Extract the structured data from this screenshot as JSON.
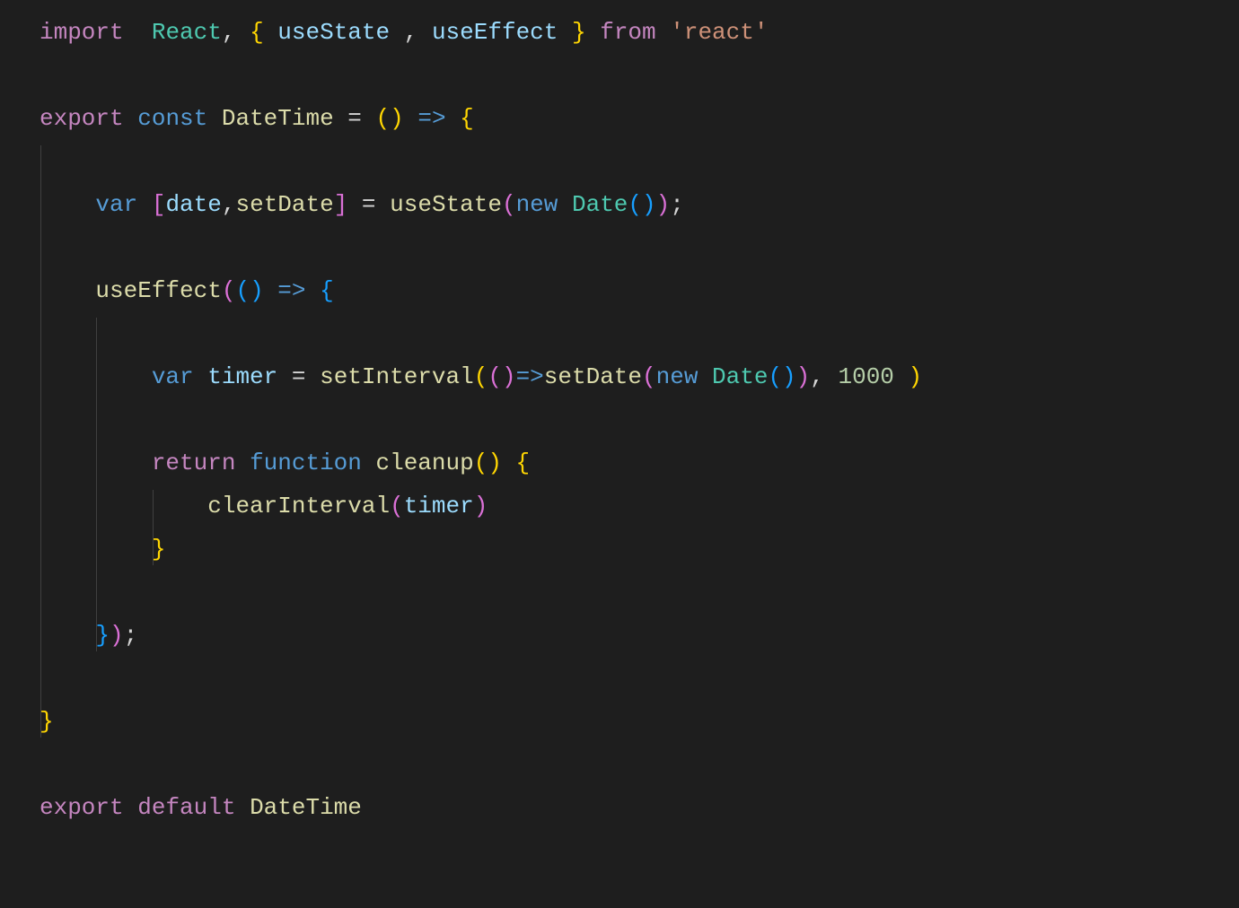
{
  "code": {
    "lines": [
      {
        "indent": 0,
        "tokens": [
          {
            "cls": "kw-import",
            "t": "import"
          },
          {
            "cls": "ident",
            "t": "  "
          },
          {
            "cls": "type",
            "t": "React"
          },
          {
            "cls": "punct",
            "t": ", "
          },
          {
            "cls": "brace-y",
            "t": "{"
          },
          {
            "cls": "ident",
            "t": " "
          },
          {
            "cls": "var-name",
            "t": "useState"
          },
          {
            "cls": "ident",
            "t": " "
          },
          {
            "cls": "punct",
            "t": ","
          },
          {
            "cls": "ident",
            "t": " "
          },
          {
            "cls": "var-name",
            "t": "useEffect"
          },
          {
            "cls": "ident",
            "t": " "
          },
          {
            "cls": "brace-y",
            "t": "}"
          },
          {
            "cls": "ident",
            "t": " "
          },
          {
            "cls": "kw-import",
            "t": "from"
          },
          {
            "cls": "ident",
            "t": " "
          },
          {
            "cls": "string",
            "t": "'react'"
          }
        ]
      },
      {
        "indent": 0,
        "tokens": []
      },
      {
        "indent": 0,
        "tokens": [
          {
            "cls": "kw-import",
            "t": "export"
          },
          {
            "cls": "ident",
            "t": " "
          },
          {
            "cls": "kw-decl",
            "t": "const"
          },
          {
            "cls": "ident",
            "t": " "
          },
          {
            "cls": "fn-name",
            "t": "DateTime"
          },
          {
            "cls": "ident",
            "t": " "
          },
          {
            "cls": "eq",
            "t": "="
          },
          {
            "cls": "ident",
            "t": " "
          },
          {
            "cls": "brace-y",
            "t": "()"
          },
          {
            "cls": "ident",
            "t": " "
          },
          {
            "cls": "kw-decl",
            "t": "=>"
          },
          {
            "cls": "ident",
            "t": " "
          },
          {
            "cls": "brace-y",
            "t": "{"
          }
        ]
      },
      {
        "indent": 0,
        "tokens": []
      },
      {
        "indent": 4,
        "tokens": [
          {
            "cls": "kw-decl",
            "t": "var"
          },
          {
            "cls": "ident",
            "t": " "
          },
          {
            "cls": "brace-p",
            "t": "["
          },
          {
            "cls": "var-name",
            "t": "date"
          },
          {
            "cls": "punct",
            "t": ","
          },
          {
            "cls": "fn-name",
            "t": "setDate"
          },
          {
            "cls": "brace-p",
            "t": "]"
          },
          {
            "cls": "ident",
            "t": " "
          },
          {
            "cls": "eq",
            "t": "="
          },
          {
            "cls": "ident",
            "t": " "
          },
          {
            "cls": "fn-name",
            "t": "useState"
          },
          {
            "cls": "brace-p",
            "t": "("
          },
          {
            "cls": "kw-decl",
            "t": "new"
          },
          {
            "cls": "ident",
            "t": " "
          },
          {
            "cls": "type",
            "t": "Date"
          },
          {
            "cls": "brace-b",
            "t": "()"
          },
          {
            "cls": "brace-p",
            "t": ")"
          },
          {
            "cls": "punct",
            "t": ";"
          }
        ]
      },
      {
        "indent": 4,
        "tokens": []
      },
      {
        "indent": 4,
        "tokens": [
          {
            "cls": "fn-name",
            "t": "useEffect"
          },
          {
            "cls": "brace-p",
            "t": "("
          },
          {
            "cls": "brace-b",
            "t": "()"
          },
          {
            "cls": "ident",
            "t": " "
          },
          {
            "cls": "kw-decl",
            "t": "=>"
          },
          {
            "cls": "ident",
            "t": " "
          },
          {
            "cls": "brace-b",
            "t": "{"
          }
        ]
      },
      {
        "indent": 8,
        "tokens": []
      },
      {
        "indent": 8,
        "tokens": [
          {
            "cls": "kw-decl",
            "t": "var"
          },
          {
            "cls": "ident",
            "t": " "
          },
          {
            "cls": "var-name",
            "t": "timer"
          },
          {
            "cls": "ident",
            "t": " "
          },
          {
            "cls": "eq",
            "t": "="
          },
          {
            "cls": "ident",
            "t": " "
          },
          {
            "cls": "fn-name",
            "t": "setInterval"
          },
          {
            "cls": "brace-y",
            "t": "("
          },
          {
            "cls": "brace-p",
            "t": "()"
          },
          {
            "cls": "kw-decl",
            "t": "=>"
          },
          {
            "cls": "fn-name",
            "t": "setDate"
          },
          {
            "cls": "brace-p",
            "t": "("
          },
          {
            "cls": "kw-decl",
            "t": "new"
          },
          {
            "cls": "ident",
            "t": " "
          },
          {
            "cls": "type",
            "t": "Date"
          },
          {
            "cls": "brace-b",
            "t": "()"
          },
          {
            "cls": "brace-p",
            "t": ")"
          },
          {
            "cls": "punct",
            "t": ", "
          },
          {
            "cls": "num",
            "t": "1000"
          },
          {
            "cls": "ident",
            "t": " "
          },
          {
            "cls": "brace-y",
            "t": ")"
          }
        ]
      },
      {
        "indent": 8,
        "tokens": []
      },
      {
        "indent": 8,
        "tokens": [
          {
            "cls": "kw-import",
            "t": "return"
          },
          {
            "cls": "ident",
            "t": " "
          },
          {
            "cls": "kw-decl",
            "t": "function"
          },
          {
            "cls": "ident",
            "t": " "
          },
          {
            "cls": "fn-name",
            "t": "cleanup"
          },
          {
            "cls": "brace-y",
            "t": "()"
          },
          {
            "cls": "ident",
            "t": " "
          },
          {
            "cls": "brace-y",
            "t": "{"
          }
        ]
      },
      {
        "indent": 12,
        "tokens": [
          {
            "cls": "fn-name",
            "t": "clearInterval"
          },
          {
            "cls": "brace-p",
            "t": "("
          },
          {
            "cls": "var-name",
            "t": "timer"
          },
          {
            "cls": "brace-p",
            "t": ")"
          }
        ]
      },
      {
        "indent": 8,
        "tokens": [
          {
            "cls": "brace-y",
            "t": "}"
          }
        ]
      },
      {
        "indent": 4,
        "tokens": []
      },
      {
        "indent": 4,
        "tokens": [
          {
            "cls": "brace-b",
            "t": "}"
          },
          {
            "cls": "brace-p",
            "t": ")"
          },
          {
            "cls": "punct",
            "t": ";"
          }
        ]
      },
      {
        "indent": 0,
        "tokens": []
      },
      {
        "indent": 0,
        "tokens": [
          {
            "cls": "brace-y",
            "t": "}"
          }
        ]
      },
      {
        "indent": 0,
        "tokens": []
      },
      {
        "indent": 0,
        "tokens": [
          {
            "cls": "kw-import",
            "t": "export"
          },
          {
            "cls": "ident",
            "t": " "
          },
          {
            "cls": "kw-import",
            "t": "default"
          },
          {
            "cls": "ident",
            "t": " "
          },
          {
            "cls": "fn-name",
            "t": "DateTime"
          }
        ]
      }
    ],
    "guides": [
      {
        "col": 0,
        "fromLine": 3,
        "toLine": 16
      },
      {
        "col": 4,
        "fromLine": 7,
        "toLine": 14
      },
      {
        "col": 8,
        "fromLine": 11,
        "toLine": 12
      }
    ]
  },
  "theme": {
    "background": "#1e1e1e"
  }
}
